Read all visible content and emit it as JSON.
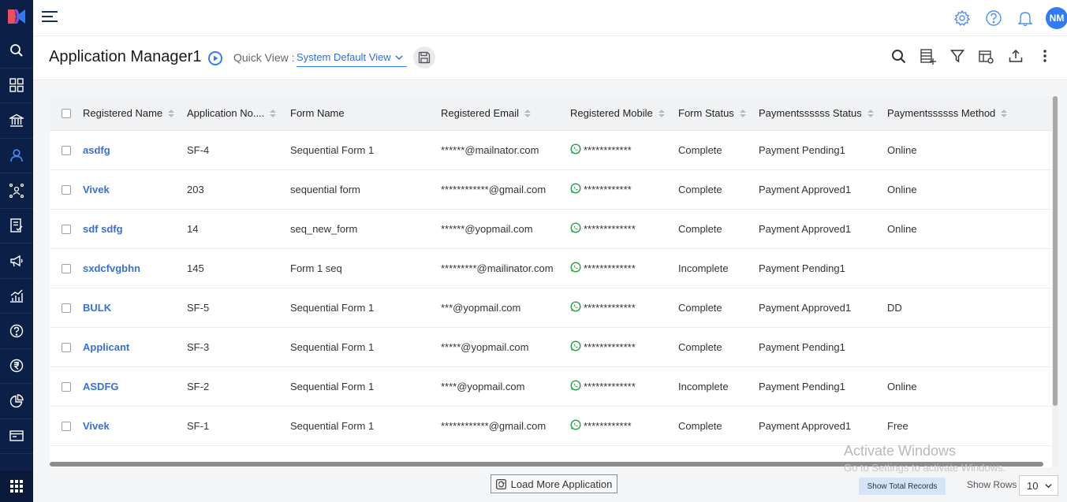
{
  "app": {
    "page_title": "Application Manager1",
    "user_initials": "NM"
  },
  "quick_view": {
    "label": "Quick View :",
    "selected": "System Default View"
  },
  "table": {
    "columns": [
      "Registered Name",
      "Application No....",
      "Form Name",
      "Registered Email",
      "Registered Mobile",
      "Form Status",
      "Paymentssssss Status",
      "Paymentssssss Method"
    ],
    "rows": [
      {
        "name": "asdfg",
        "app_no": "SF-4",
        "form": "Sequential Form 1",
        "email": "******@mailnator.com",
        "mobile": "************",
        "status": "Complete",
        "pay_status": "Payment Pending1",
        "pay_method": "Online"
      },
      {
        "name": "Vivek",
        "app_no": "203",
        "form": "sequential form",
        "email": "************@gmail.com",
        "mobile": "************",
        "status": "Complete",
        "pay_status": "Payment Approved1",
        "pay_method": "Online"
      },
      {
        "name": "sdf sdfg",
        "app_no": "14",
        "form": "seq_new_form",
        "email": "******@yopmail.com",
        "mobile": "*************",
        "status": "Complete",
        "pay_status": "Payment Approved1",
        "pay_method": "Online"
      },
      {
        "name": "sxdcfvgbhn",
        "app_no": "145",
        "form": "Form 1 seq",
        "email": "*********@mailinator.com",
        "mobile": "*************",
        "status": "Incomplete",
        "pay_status": "Payment Pending1",
        "pay_method": ""
      },
      {
        "name": "BULK",
        "app_no": "SF-5",
        "form": "Sequential Form 1",
        "email": "***@yopmail.com",
        "mobile": "*************",
        "status": "Complete",
        "pay_status": "Payment Approved1",
        "pay_method": "DD"
      },
      {
        "name": "Applicant",
        "app_no": "SF-3",
        "form": "Sequential Form 1",
        "email": "*****@yopmail.com",
        "mobile": "*************",
        "status": "Complete",
        "pay_status": "Payment Pending1",
        "pay_method": ""
      },
      {
        "name": "ASDFG",
        "app_no": "SF-2",
        "form": "Sequential Form 1",
        "email": "****@yopmail.com",
        "mobile": "*************",
        "status": "Incomplete",
        "pay_status": "Payment Pending1",
        "pay_method": "Online"
      },
      {
        "name": "Vivek",
        "app_no": "SF-1",
        "form": "Sequential Form 1",
        "email": "************@gmail.com",
        "mobile": "************",
        "status": "Complete",
        "pay_status": "Payment Approved1",
        "pay_method": "Free"
      }
    ]
  },
  "footer": {
    "load_more": "Load More Application",
    "show_total": "Show Total Records",
    "show_rows_label": "Show Rows",
    "rows_value": "10"
  },
  "watermark": {
    "line1": "Activate Windows",
    "line2": "Go to Settings to activate Windows."
  },
  "colors": {
    "sidebar": "#0c2047",
    "accent": "#2f7cf6",
    "link": "#3a6fd0",
    "whatsapp": "#25a244"
  }
}
